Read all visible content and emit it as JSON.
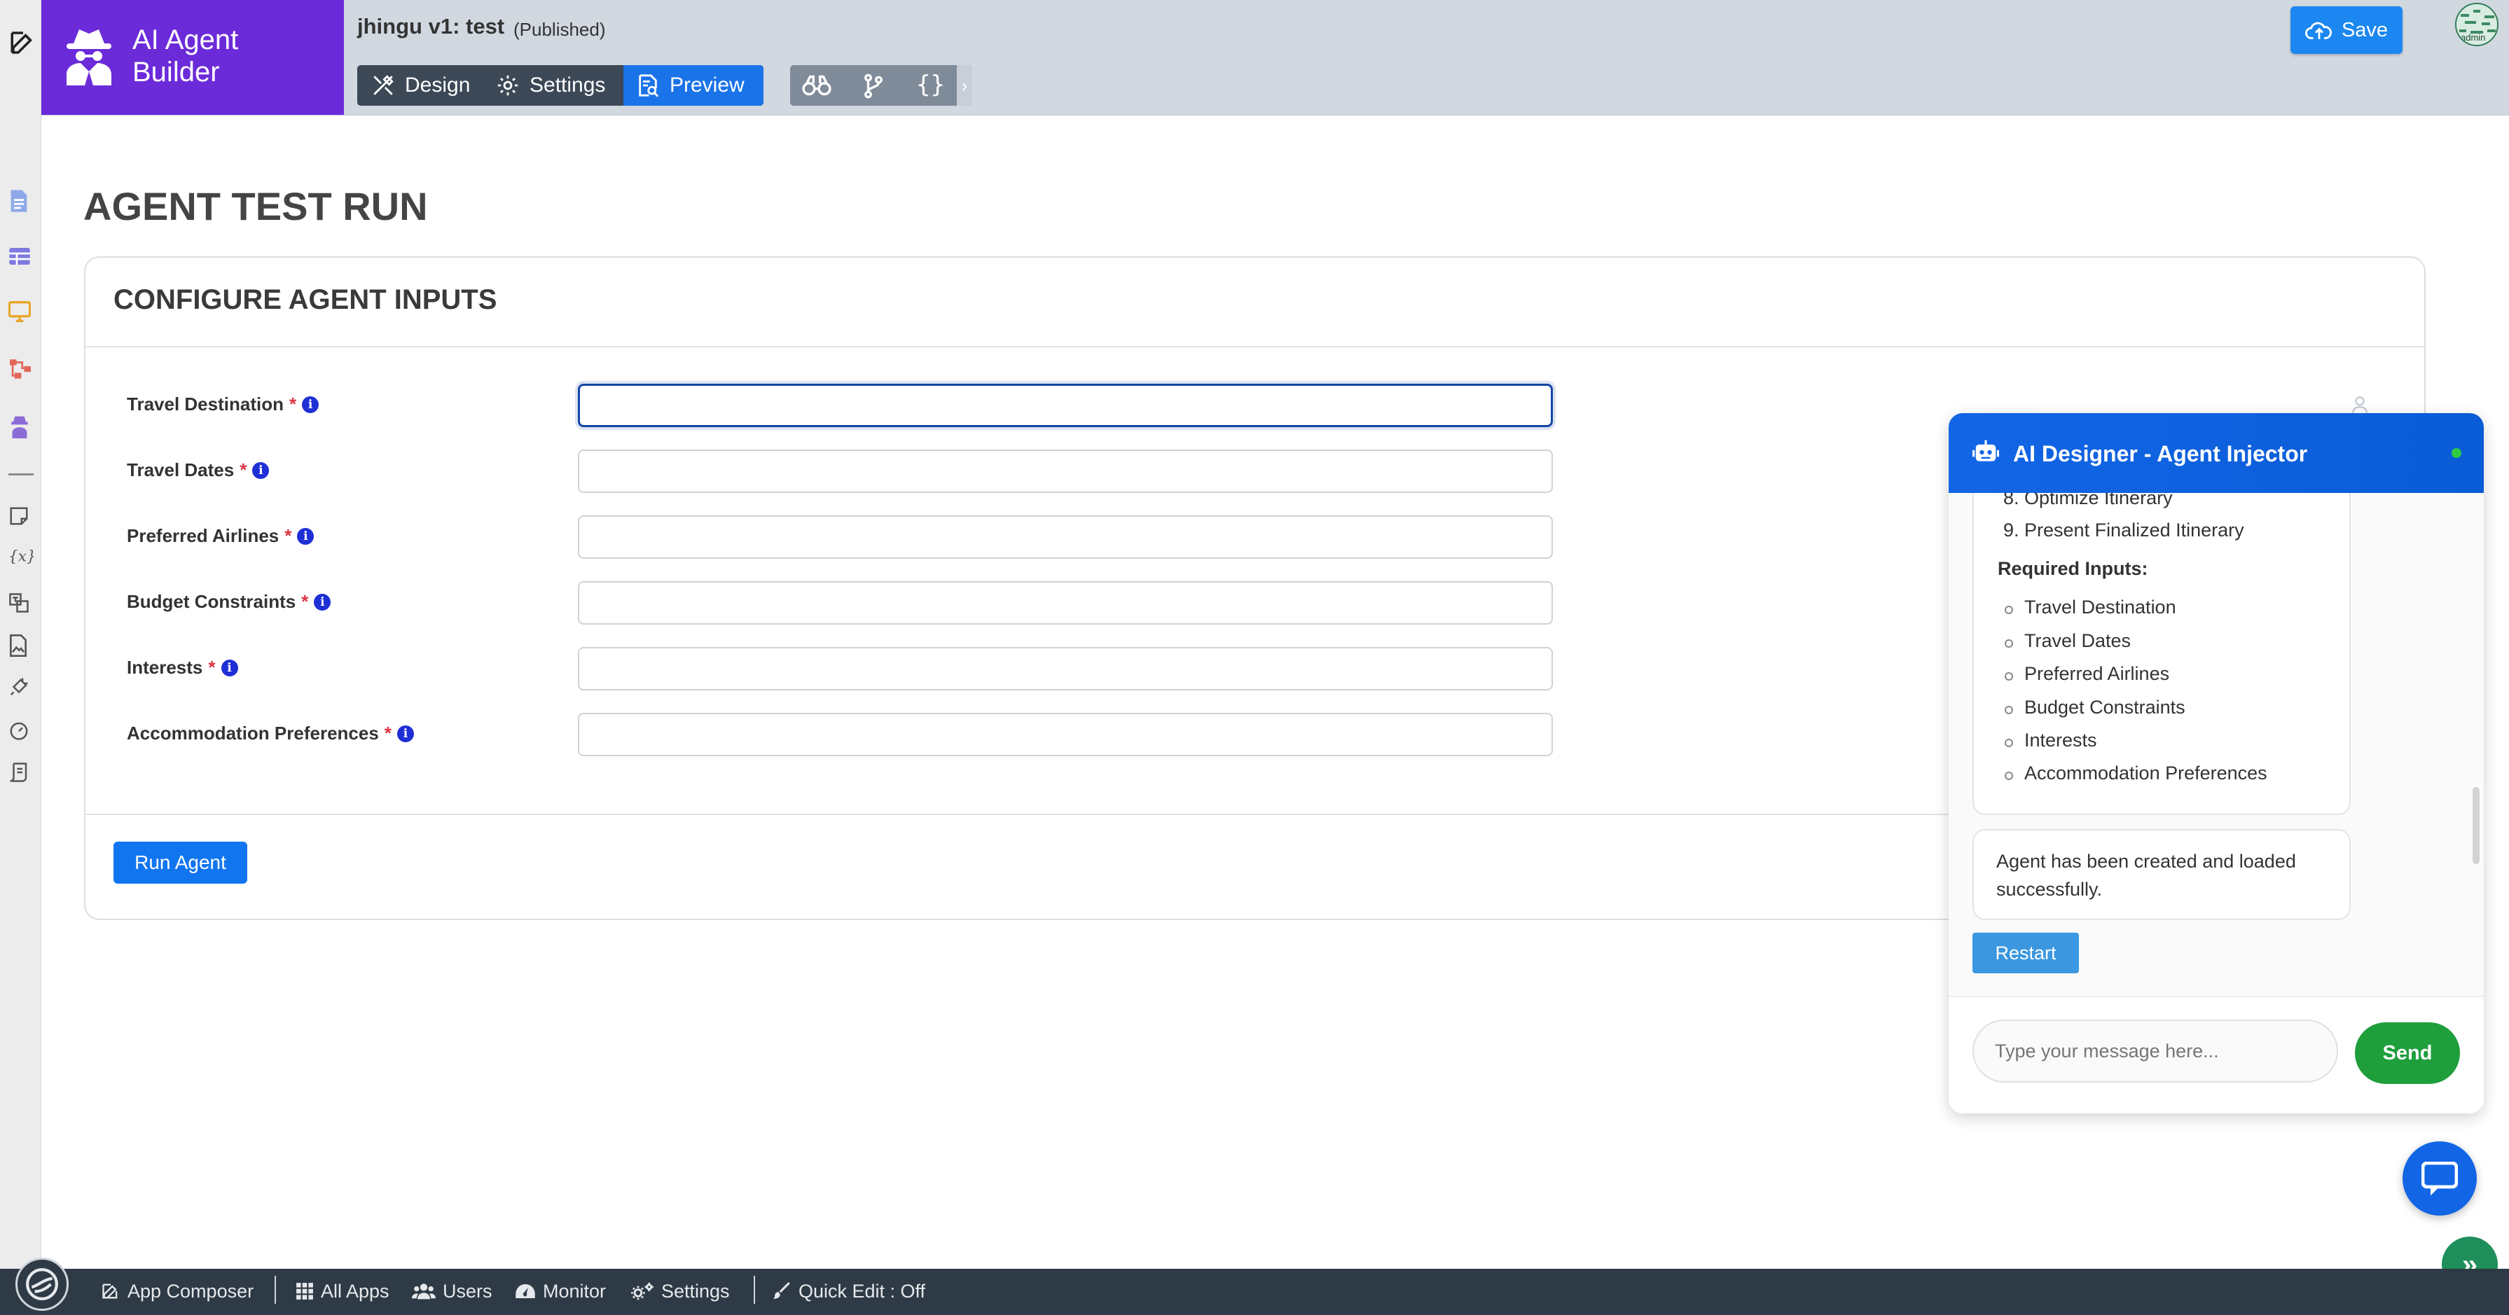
{
  "brand": {
    "line1": "AI Agent",
    "line2": "Builder"
  },
  "app": {
    "title": "jhingu v1: test",
    "status": "(Published)"
  },
  "tabs": {
    "design": "Design",
    "settings": "Settings",
    "preview": "Preview"
  },
  "toolbar": {
    "save_label": "Save"
  },
  "avatar": {
    "label": "admin"
  },
  "page": {
    "title": "AGENT TEST RUN"
  },
  "card": {
    "title": "CONFIGURE AGENT INPUTS",
    "required_mark": "*",
    "info_glyph": "i",
    "fields": [
      {
        "label": "Travel Destination",
        "value": ""
      },
      {
        "label": "Travel Dates",
        "value": ""
      },
      {
        "label": "Preferred Airlines",
        "value": ""
      },
      {
        "label": "Budget Constraints",
        "value": ""
      },
      {
        "label": "Interests",
        "value": ""
      },
      {
        "label": "Accommodation Preferences",
        "value": ""
      }
    ],
    "run_label": "Run Agent"
  },
  "chat": {
    "title": "AI Designer - Agent Injector",
    "steps": [
      "8. Optimize Itinerary",
      "9. Present Finalized Itinerary"
    ],
    "required_heading": "Required Inputs:",
    "required_inputs": [
      "Travel Destination",
      "Travel Dates",
      "Preferred Airlines",
      "Budget Constraints",
      "Interests",
      "Accommodation Preferences"
    ],
    "status_message": "Agent has been created and loaded successfully.",
    "restart_label": "Restart",
    "input_placeholder": "Type your message here...",
    "send_label": "Send"
  },
  "bottombar": {
    "app_composer": "App Composer",
    "all_apps": "All Apps",
    "users": "Users",
    "monitor": "Monitor",
    "settings": "Settings",
    "quick_edit": "Quick Edit : Off"
  },
  "colors": {
    "brand": "#6c2bd9",
    "primary": "#1275f0",
    "send": "#1f9e3c",
    "bottombar": "#2e3a45",
    "required": "#dc3545"
  }
}
